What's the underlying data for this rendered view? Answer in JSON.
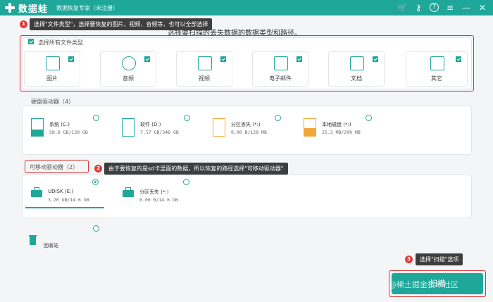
{
  "titlebar": {
    "brand": "数据蛙",
    "subtitle": "数据恢复专家（未注册）",
    "icons": [
      "cart-icon",
      "key-icon",
      "help-icon",
      "menu-icon",
      "minimize-icon",
      "close-icon"
    ],
    "icon_glyphs": {
      "cart": "🛒",
      "key": "⚷",
      "help": "?",
      "menu": "≡",
      "minimize": "—",
      "close": "✕"
    }
  },
  "prompt": "选择要扫描的丢失数据的数据类型和路径。",
  "callouts": {
    "c1": {
      "num": "1",
      "text": "选择\"文件类型\"，选择要恢复的图片、视频、音频等，也可以全部选择"
    },
    "c2": {
      "num": "2",
      "text": "由于要恢复的是sd卡里面的数据，所以恢复的路径选择\"可移动驱动器\""
    },
    "c3": {
      "num": "3",
      "text": "选择\"扫描\"选项"
    }
  },
  "file_types": {
    "select_all": "选择所有文件类型",
    "items": [
      {
        "label": "图片"
      },
      {
        "label": "音频"
      },
      {
        "label": "视频"
      },
      {
        "label": "电子邮件"
      },
      {
        "label": "文档"
      },
      {
        "label": "其它"
      }
    ]
  },
  "hdd": {
    "title": "硬盘驱动器（4）",
    "drives": [
      {
        "name": "系统 (C:)",
        "size": "58.6 GB/130 GB"
      },
      {
        "name": "软件 (D:)",
        "size": "7.57 GB/346 GB"
      },
      {
        "name": "分区丢失 (*:)",
        "size": "0.00  B/128 MB"
      },
      {
        "name": "本地磁盘 (*:)",
        "size": "25.3 MB/299 MB"
      }
    ]
  },
  "removable": {
    "title": "可移动驱动器（2）",
    "drives": [
      {
        "name": "UDISK (E:)",
        "size": "3.20 GB/14.6 GB"
      },
      {
        "name": "分区丢失 (*:)",
        "size": "0.00  B/14.6 GB"
      }
    ]
  },
  "recycle": {
    "label": "回收站"
  },
  "scan_button": "扫描",
  "watermark": "@稀土掘金技术社区",
  "colors": {
    "accent": "#1fa79a",
    "callout_bg": "#3e3e3e",
    "highlight": "#dd3333"
  }
}
